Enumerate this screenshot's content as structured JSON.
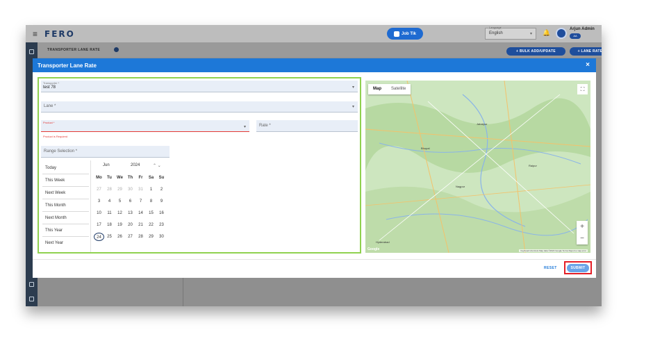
{
  "app": {
    "logo": "FERO",
    "job_button": "Job Tik",
    "language": {
      "label": "Language",
      "value": "English"
    },
    "user": {
      "name": "Arjun Admin",
      "role": "AA"
    }
  },
  "page": {
    "title": "TRANSPORTER LANE RATE",
    "bulk_button": "+ BULK ADD/UPDATE",
    "lane_rate_button": "+ LANE RATE"
  },
  "modal": {
    "title": "Transporter Lane Rate",
    "close": "×",
    "form": {
      "transporter": {
        "label": "Transporter *",
        "value": "test 78"
      },
      "lane": {
        "placeholder": "Lane *"
      },
      "product": {
        "label": "Product *",
        "error": "Product is Required"
      },
      "rate": {
        "placeholder": "Rate *"
      },
      "range": {
        "placeholder": "Range Selection *"
      }
    },
    "presets": [
      "Today",
      "This Week",
      "Next Week",
      "This Month",
      "Next Month",
      "This Year",
      "Next Year"
    ],
    "calendar": {
      "month": "Jun",
      "year": "2024",
      "weekdays": [
        "Mo",
        "Tu",
        "We",
        "Th",
        "Fr",
        "Sa",
        "Su"
      ],
      "days": [
        "27",
        "28",
        "29",
        "30",
        "31",
        "1",
        "2",
        "3",
        "4",
        "5",
        "6",
        "7",
        "8",
        "9",
        "10",
        "11",
        "12",
        "13",
        "14",
        "15",
        "16",
        "17",
        "18",
        "19",
        "20",
        "21",
        "22",
        "23",
        "24",
        "25",
        "26",
        "27",
        "28",
        "29",
        "30"
      ],
      "selected": "24"
    },
    "map": {
      "tabs": [
        "Map",
        "Satellite"
      ],
      "active_tab": "Map",
      "cities": [
        "Jabalpur",
        "Raipur",
        "Bhopal",
        "Nagpur",
        "Hyderabad"
      ],
      "logo": "Google",
      "attribution": "Keyboard shortcuts  Map data ©2024 Google  Terms  Report a map error"
    },
    "reset_label": "RESET",
    "submit_label": "SUBMIT"
  },
  "colors": {
    "primary": "#1d78d8",
    "highlight_form": "#8fd14f",
    "highlight_submit": "#e41e26"
  }
}
